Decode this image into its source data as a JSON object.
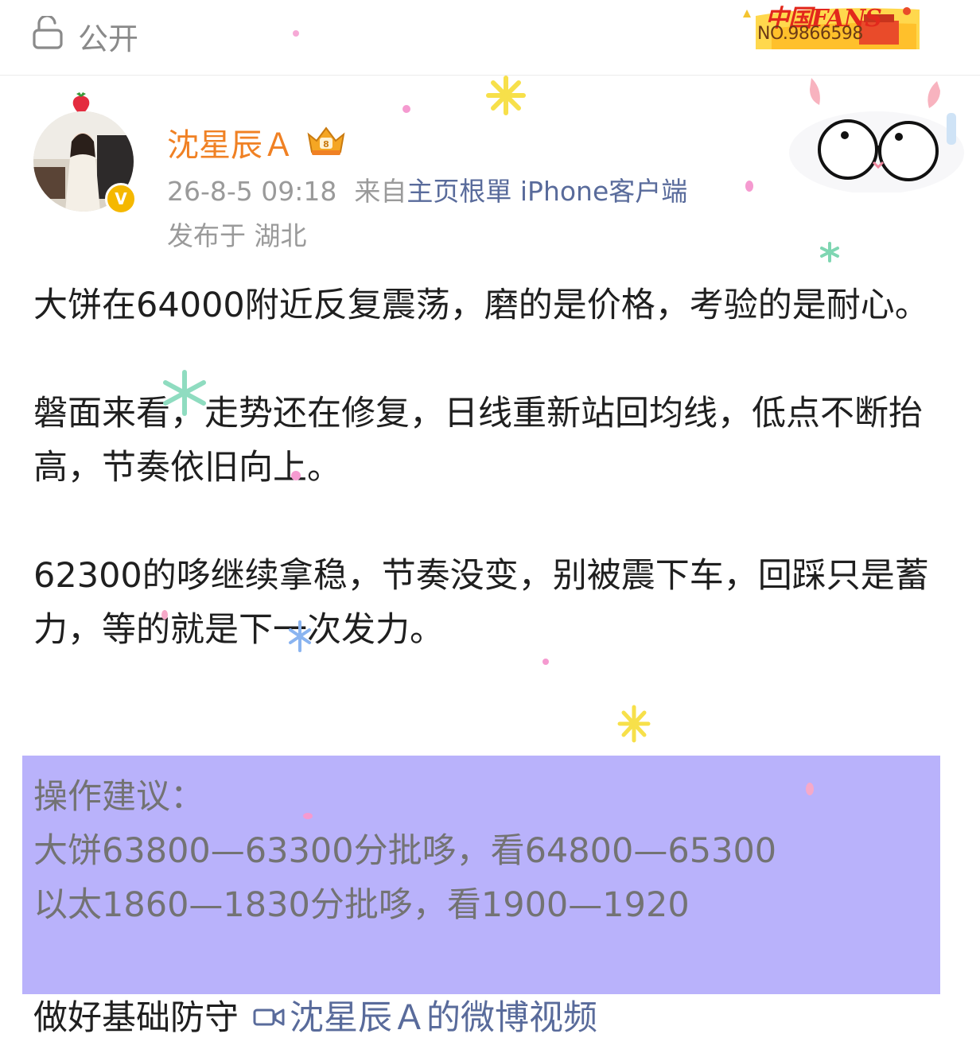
{
  "visibility": {
    "icon": "lock-open-icon",
    "label": "公开"
  },
  "fans_badge": {
    "title": "中国FANS",
    "number": "NO.9866598"
  },
  "post": {
    "author": {
      "name": "沈星辰Ａ",
      "verified_badge": "V",
      "member_icon": "crown-badge-icon"
    },
    "time": "26-8-5 09:18",
    "source_prefix": "来自",
    "source": "主页根單 iPhone客户端",
    "location": "发布于 湖北",
    "paragraphs": [
      "大饼在64000附近反复震荡，磨的是价格，考验的是耐心。",
      "磐面来看，走势还在修复，日线重新站回均线，低点不断抬高，节奏依旧向上。",
      "62300的哆继续拿稳，节奏没变，别被震下车，回踩只是蓄力，等的就是下一次发力。"
    ],
    "advice": {
      "heading": "操作建议：",
      "lines": [
        "大饼63800—63300分批哆，看64800—65300",
        "以太1860—1830分批哆，看1900—1920"
      ]
    },
    "footer_text": "做好基础防守",
    "video_link": "沈星辰Ａ的微博视频"
  },
  "colors": {
    "username": "#f08124",
    "link": "#596b9b",
    "highlight": "#b9b2fb",
    "meta": "#9a9a9a"
  }
}
